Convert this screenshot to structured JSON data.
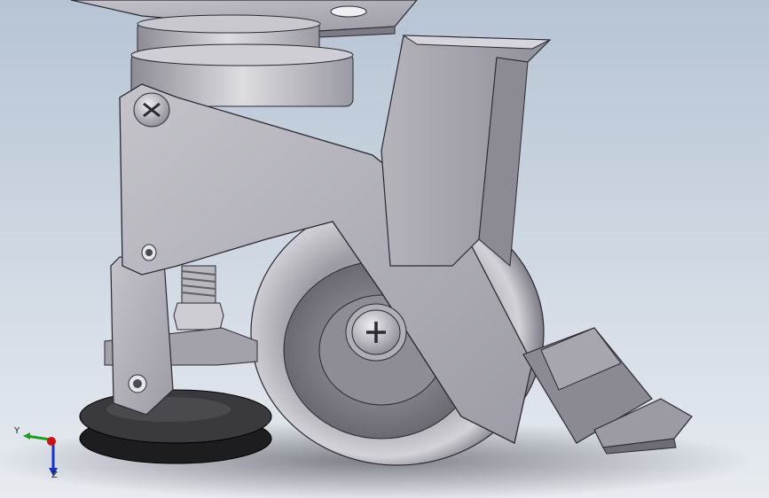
{
  "viewport": {
    "background_top": "#b6c4d4",
    "background_bottom": "#e7ebf0"
  },
  "model": {
    "metal_light": "#d7d6db",
    "metal_mid": "#a9a8b0",
    "metal_dark": "#6f6e78",
    "rubber": "#1d1d1f",
    "edge": "#2a2a30"
  },
  "triad": {
    "y_label": "Y",
    "z_label": "Z",
    "x_color": "#1aa01a",
    "y_color": "#1aa01a",
    "z_color": "#1133cc",
    "origin_color": "#d01010"
  }
}
